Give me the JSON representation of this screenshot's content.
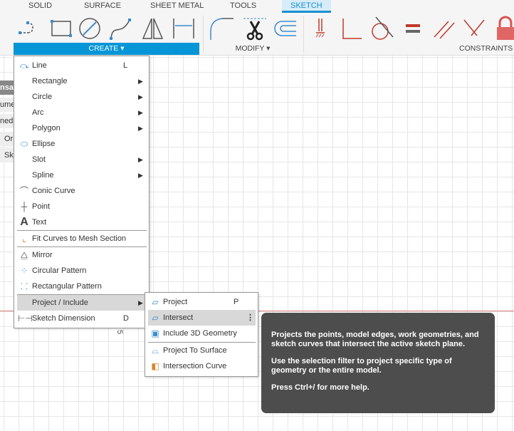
{
  "tabs": [
    "SOLID",
    "SURFACE",
    "SHEET METAL",
    "TOOLS",
    "SKETCH"
  ],
  "groups": {
    "create": "CREATE ▾",
    "modify": "MODIFY ▾",
    "constraints": "CONSTRAINTS ▾"
  },
  "left_panel": [
    "nsa",
    "ume",
    "ned Y",
    "Or",
    "Sk"
  ],
  "create_menu": [
    {
      "label": "Line",
      "shortcut": "L",
      "icon": "line-icon"
    },
    {
      "label": "Rectangle",
      "submenu": true
    },
    {
      "label": "Circle",
      "submenu": true
    },
    {
      "label": "Arc",
      "submenu": true
    },
    {
      "label": "Polygon",
      "submenu": true
    },
    {
      "label": "Ellipse",
      "icon": "ellipse-icon"
    },
    {
      "label": "Slot",
      "submenu": true
    },
    {
      "label": "Spline",
      "submenu": true
    },
    {
      "label": "Conic Curve",
      "icon": "conic-curve-icon"
    },
    {
      "label": "Point",
      "icon": "point-icon"
    },
    {
      "label": "Text",
      "icon": "text-icon"
    },
    {
      "label": "Fit Curves to Mesh Section",
      "icon": "fit-curves-icon"
    },
    {
      "label": "Mirror",
      "icon": "mirror-icon"
    },
    {
      "label": "Circular Pattern",
      "icon": "circular-pattern-icon"
    },
    {
      "label": "Rectangular Pattern",
      "icon": "rectangular-pattern-icon"
    },
    {
      "label": "Project / Include",
      "submenu": true
    },
    {
      "label": "Sketch Dimension",
      "shortcut": "D",
      "icon": "sketch-dimension-icon"
    }
  ],
  "project_submenu": [
    {
      "label": "Project",
      "shortcut": "P"
    },
    {
      "label": "Intersect",
      "more": "⋮"
    },
    {
      "label": "Include 3D Geometry"
    },
    {
      "label": "Project To Surface"
    },
    {
      "label": "Intersection Curve"
    }
  ],
  "canvas_label": "5",
  "tooltip": [
    "Projects the points, model edges, work geometries, and sketch curves that intersect the active sketch plane.",
    "Use the selection filter to project specific type of geometry or the entire model.",
    "Press Ctrl+/ for more help."
  ],
  "colors": {
    "accent": "#0696d7",
    "constraint": "#c0392b"
  }
}
